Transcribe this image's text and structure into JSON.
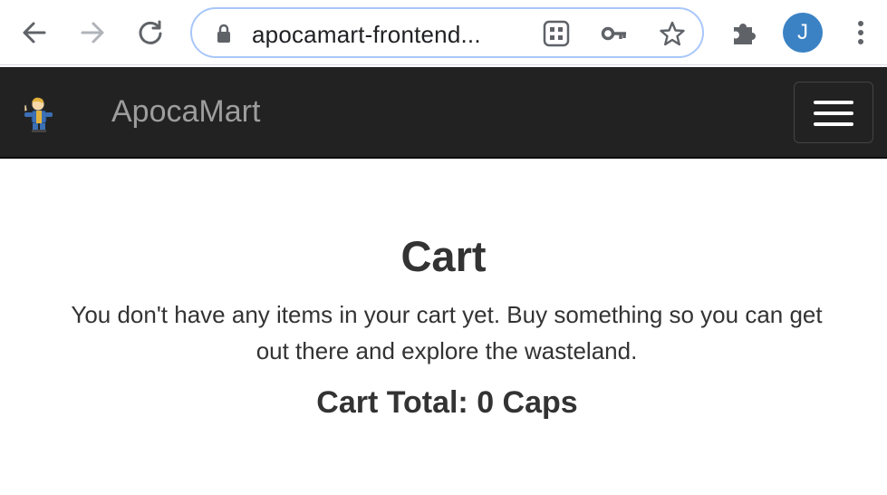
{
  "browser": {
    "url": "apocamart-frontend...",
    "profile_initial": "J",
    "icons": {
      "back": "arrow-left",
      "forward": "arrow-right",
      "reload": "reload",
      "lock": "lock",
      "qr": "qr-code",
      "key": "key",
      "star": "star",
      "extensions": "puzzle",
      "menu": "kebab-menu"
    }
  },
  "navbar": {
    "brand": "ApocaMart",
    "logo_icon": "vault-boy-thumbs-up",
    "toggle_icon": "hamburger-menu",
    "background": "#222222",
    "brand_color": "#9d9d9d"
  },
  "cart": {
    "title": "Cart",
    "empty_message": "You don't have any items in your cart yet. Buy something so you can get out there and explore the wasteland.",
    "total_label": "Cart Total: 0 Caps"
  }
}
